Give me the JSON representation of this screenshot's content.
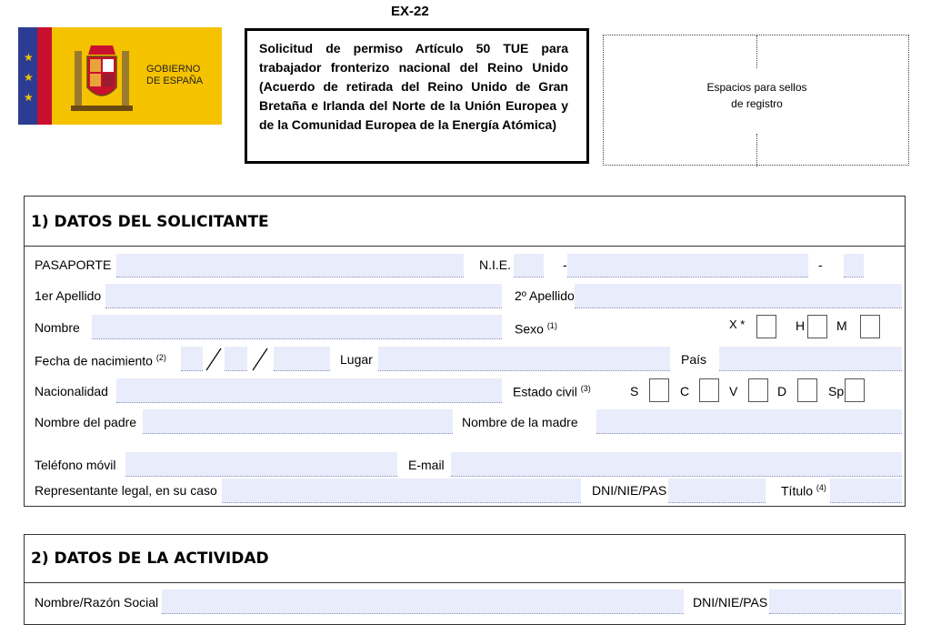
{
  "form_code": "EX-22",
  "logo": {
    "line1": "GOBIERNO",
    "line2": "DE ESPAÑA"
  },
  "title": "Solicitud de permiso Artículo 50 TUE para trabajador fronterizo nacional del Reino Unido (Acuerdo de retirada del Reino Unido de Gran Bretaña e Irlanda del Norte de la Unión Europea y de la Comunidad Europea de la Energía Atómica)",
  "stamp": {
    "line1": "Espacios para sellos",
    "line2": "de registro"
  },
  "section1": {
    "heading": "1)  DATOS DEL SOLICITANTE",
    "pasaporte": "PASAPORTE",
    "nie": "N.I.E.",
    "dash": "-",
    "apellido1": "1er Apellido",
    "apellido2": "2º Apellido",
    "nombre": "Nombre",
    "sexo": "Sexo",
    "sexo_ref": "(1)",
    "sex_x": "X *",
    "sex_h": "H",
    "sex_m": "M",
    "fecha": "Fecha de nacimiento",
    "fecha_ref": "(2)",
    "lugar": "Lugar",
    "pais": "País",
    "nacionalidad": "Nacionalidad",
    "estado_civil": "Estado civil",
    "estado_ref": "(3)",
    "estado_options": [
      "S",
      "C",
      "V",
      "D",
      "Sp"
    ],
    "padre": "Nombre del padre",
    "madre": "Nombre de la madre",
    "telefono": "Teléfono móvil",
    "email": "E-mail",
    "representante": "Representante legal, en su caso",
    "dni": "DNI/NIE/PAS",
    "titulo": "Título",
    "titulo_ref": "(4)"
  },
  "section2": {
    "heading": "2)  DATOS DE LA ACTIVIDAD",
    "razon_social": "Nombre/Razón Social",
    "dni": "DNI/NIE/PAS"
  }
}
